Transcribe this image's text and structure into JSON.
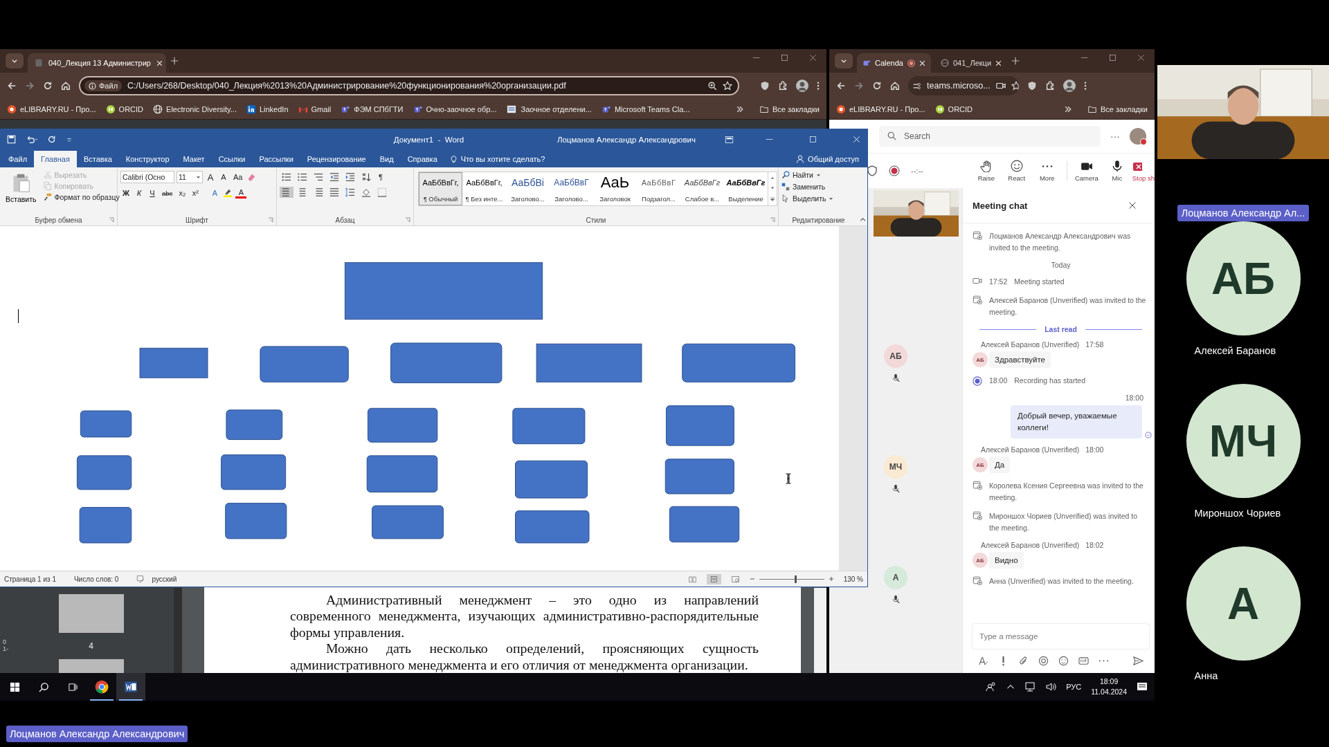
{
  "left_browser": {
    "tabs": [
      {
        "title": "040_Лекция 13 Администрир",
        "selected": true
      }
    ],
    "address_badge": "Файл",
    "address": "C:/Users/268/Desktop/040_Лекция%2013%20Администрирование%20функционирования%20организации.pdf",
    "bookmarks": [
      {
        "label": "eLIBRARY.RU - Про...",
        "kind": "elibrary"
      },
      {
        "label": "ORCID",
        "kind": "orcid"
      },
      {
        "label": "Electronic Diversity...",
        "kind": "globe"
      },
      {
        "label": "LinkedIn",
        "kind": "linkedin"
      },
      {
        "label": "Gmail",
        "kind": "gmail"
      },
      {
        "label": "ФЭМ СПбГТИ",
        "kind": "teams"
      },
      {
        "label": "Очно-заочное обр...",
        "kind": "teams"
      },
      {
        "label": "Заочное отделени...",
        "kind": "doc"
      },
      {
        "label": "Microsoft Teams Cla...",
        "kind": "teams"
      }
    ],
    "all_bookmarks": "Все закладки",
    "pdf": {
      "thumbnail_label": "4",
      "edge_marks": [
        "0",
        "1-"
      ],
      "paragraphs": [
        "Административный менеджмент – это одно из направлений современного менеджмента, изучающих административно-распорядительные формы управления.",
        "Можно дать несколько определений, проясняющих сущность административного менеджмента и его отличия от менеджмента организации."
      ]
    }
  },
  "word": {
    "title": "Документ1  -  Word",
    "user": "Лоцманов Александр Александрович",
    "tabs": [
      {
        "label": "Файл",
        "selected": false
      },
      {
        "label": "Главная",
        "selected": true
      },
      {
        "label": "Вставка",
        "selected": false
      },
      {
        "label": "Конструктор",
        "selected": false
      },
      {
        "label": "Макет",
        "selected": false
      },
      {
        "label": "Ссылки",
        "selected": false
      },
      {
        "label": "Рассылки",
        "selected": false
      },
      {
        "label": "Рецензирование",
        "selected": false
      },
      {
        "label": "Вид",
        "selected": false
      },
      {
        "label": "Справка",
        "selected": false
      }
    ],
    "tell_me": "Что вы хотите сделать?",
    "share": "Общий доступ",
    "clipboard": {
      "group": "Буфер обмена",
      "paste": "Вставить",
      "tools": [
        {
          "label": "Вырезать",
          "kind": "cut",
          "disabled": true
        },
        {
          "label": "Копировать",
          "kind": "copy",
          "disabled": true
        },
        {
          "label": "Формат по образцу",
          "kind": "painter",
          "disabled": false
        }
      ]
    },
    "font": {
      "group": "Шрифт",
      "family": "Calibri (Осно",
      "size": "11",
      "grow": "A",
      "shrink": "A",
      "case": "Aa",
      "format_buttons": [
        "Ж",
        "К",
        "Ч",
        "abc",
        "x₂",
        "x²"
      ],
      "effects": "A",
      "color_button": "A"
    },
    "paragraph": {
      "group": "Абзац",
      "marks": "¶"
    },
    "styles": {
      "group": "Стили",
      "items": [
        {
          "sample": "АаБбВвГг,",
          "name": "¶ Обычный",
          "kind": "normal",
          "selected": true
        },
        {
          "sample": "АаБбВвГг,",
          "name": "¶ Без инте...",
          "kind": "normal",
          "selected": false
        },
        {
          "sample": "АаБбВі",
          "name": "Заголово...",
          "kind": "heading1",
          "selected": false
        },
        {
          "sample": "АаБбВвГ",
          "name": "Заголово...",
          "kind": "heading2",
          "selected": false
        },
        {
          "sample": "АаЬ",
          "name": "Заголовок",
          "kind": "title",
          "selected": false
        },
        {
          "sample": "АаБбВвГ",
          "name": "Подзагол...",
          "kind": "subtitle",
          "selected": false
        },
        {
          "sample": "АаБбВвГг",
          "name": "Слабое в...",
          "kind": "emphasis",
          "selected": false
        },
        {
          "sample": "АаБбВвГг",
          "name": "Выделение",
          "kind": "strong",
          "selected": false
        }
      ]
    },
    "editing": {
      "group": "Редактирование",
      "find": "Найти",
      "replace": "Заменить",
      "select": "Выделить"
    },
    "status": {
      "page": "Страница 1 из 1",
      "words": "Число слов: 0",
      "language": "русский",
      "zoom": "130 %",
      "zoom_slider": {
        "level": 0.55
      }
    }
  },
  "right_browser": {
    "tabs": [
      {
        "title": "Calenda",
        "selected": true,
        "recording": true
      },
      {
        "title": "041_Лекци",
        "selected": false,
        "recording": false
      }
    ],
    "address": "teams.microso...",
    "bookmarks": [
      {
        "label": "eLIBRARY.RU - Про...",
        "kind": "elibrary"
      },
      {
        "label": "ORCID",
        "kind": "orcid"
      }
    ],
    "all_bookmarks": "Все закладки"
  },
  "teams": {
    "search": {
      "placeholder": "Search"
    },
    "more": "···",
    "timer": "--:--",
    "actions": [
      {
        "label": "Raise",
        "kind": "hand"
      },
      {
        "label": "React",
        "kind": "smile"
      },
      {
        "label": "More",
        "kind": "more"
      },
      {
        "label": "Camera",
        "kind": "camera"
      },
      {
        "label": "Mic",
        "kind": "mic"
      },
      {
        "label": "Stop sh",
        "kind": "stop"
      }
    ],
    "participants": [
      {
        "initials": "АБ",
        "color": "#f3d9da"
      },
      {
        "initials": "МЧ",
        "color": "#fbead2"
      },
      {
        "initials": "А",
        "color": "#d6eadb"
      }
    ],
    "chat": {
      "title": "Meeting chat",
      "items": [
        {
          "kind": "system",
          "text": "Лоцманов Александр Александрович was invited to the meeting."
        },
        {
          "kind": "date",
          "text": "Today"
        },
        {
          "kind": "started",
          "time": "17:52",
          "text": "Meeting started"
        },
        {
          "kind": "system",
          "text": "Алексей Баранов (Unverified) was invited to the meeting."
        },
        {
          "kind": "divider",
          "text": "Last read"
        },
        {
          "kind": "message",
          "sender": "Алексей Баранов (Unverified)",
          "time": "17:58",
          "initials": "АБ",
          "text": "Здравствуйте"
        },
        {
          "kind": "recording",
          "time": "18:00",
          "text": "Recording has started"
        },
        {
          "kind": "own",
          "time": "18:00",
          "text": "Добрый вечер, уважаемые коллеги!"
        },
        {
          "kind": "message",
          "sender": "Алексей Баранов (Unverified)",
          "time": "18:00",
          "initials": "АБ",
          "text": "Да"
        },
        {
          "kind": "system",
          "text": "Королева Ксения Сергеевна was invited to the meeting."
        },
        {
          "kind": "system",
          "text": "Мироншох Чориев (Unverified) was invited to the meeting."
        },
        {
          "kind": "message",
          "sender": "Алексей Баранов (Unverified)",
          "time": "18:02",
          "initials": "АБ",
          "text": "Видно"
        },
        {
          "kind": "system",
          "text": "Анна (Unverified) was invited to the meeting."
        }
      ],
      "compose": {
        "placeholder": "Type a message"
      }
    }
  },
  "stage": {
    "presenter_label": "Лоцманов Александр Ал...",
    "tiles": [
      {
        "initials": "АБ",
        "name": "Алексей Баранов"
      },
      {
        "initials": "МЧ",
        "name": "Мироншох Чориев"
      },
      {
        "initials": "А",
        "name": "Анна"
      }
    ]
  },
  "taskbar": {
    "apps": [
      {
        "kind": "chrome",
        "selected": false
      },
      {
        "kind": "word",
        "selected": true
      }
    ],
    "language": "РУС",
    "time": "18:09",
    "date": "11.04.2024"
  },
  "name_tag": "Лоцманов Александр Александрович"
}
